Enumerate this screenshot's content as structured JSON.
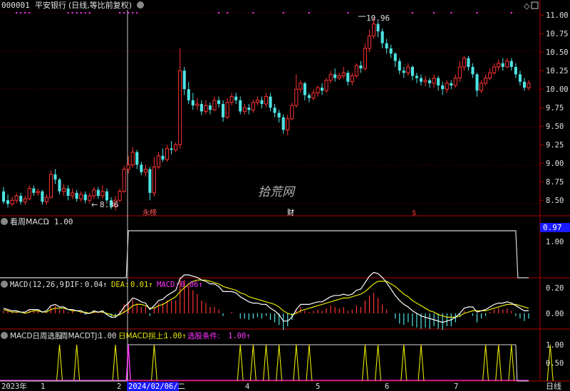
{
  "header": {
    "code": "000001",
    "name": "平安银行",
    "mode": "(日线,等比前复权)"
  },
  "watermark": "拾荒网",
  "colors": {
    "up": "#ff3333",
    "down": "#4fe3e3",
    "grid": "#7a0000",
    "axis_text": "#e0e0e0",
    "white": "#ffffff",
    "yellow": "#e6e600",
    "magenta": "#ff33ff",
    "blue_label": "#1a1aff"
  },
  "panels": {
    "price": {
      "high_label": "10.96",
      "low_label": "8.36",
      "y_ticks": [
        "11.00",
        "10.75",
        "10.50",
        "10.25",
        "10.00",
        "9.75",
        "9.50",
        "9.25",
        "9.00",
        "8.75",
        "8.50"
      ],
      "markers": [
        "永榜",
        "财",
        "$"
      ]
    },
    "weekly": {
      "title": "看周MACD",
      "value": "1.00",
      "current_label": "0.97",
      "tick": "1.00"
    },
    "macd": {
      "name": "MACD(12,26,9)",
      "dif_label": "DIF:",
      "dif": "0.04↑",
      "dea_label": "DEA:",
      "dea": "0.01↑",
      "macd_label": "MACD:",
      "macd": "0.06↑",
      "y_ticks": [
        "0.20",
        "0.00"
      ]
    },
    "signal": {
      "name": "MACD日周选股",
      "w_label": "周MACDTJ:",
      "w_value": "1.00",
      "d_label": "日MACD拐上:",
      "d_value": "1.00↑",
      "s_label": "选股条件:",
      "s_value": "1.00↑",
      "y_ticks": [
        "1.00",
        "0.50"
      ]
    }
  },
  "x_axis": {
    "labels": [
      "2023年",
      "1",
      "2",
      "2024/02/06/二",
      "4",
      "5",
      "6",
      "7"
    ],
    "period": "日线"
  },
  "chart_data": {
    "type": "candlestick",
    "y_range": [
      8.3,
      11.05
    ],
    "candles": [
      [
        8.62,
        8.48,
        8.68,
        8.45
      ],
      [
        8.5,
        8.45,
        8.58,
        8.4
      ],
      [
        8.45,
        8.5,
        8.55,
        8.42
      ],
      [
        8.5,
        8.56,
        8.6,
        8.46
      ],
      [
        8.56,
        8.48,
        8.6,
        8.44
      ],
      [
        8.48,
        8.52,
        8.56,
        8.44
      ],
      [
        8.52,
        8.66,
        8.7,
        8.5
      ],
      [
        8.66,
        8.6,
        8.7,
        8.56
      ],
      [
        8.6,
        8.62,
        8.66,
        8.56
      ],
      [
        8.62,
        8.48,
        8.64,
        8.44
      ],
      [
        8.48,
        8.54,
        8.58,
        8.44
      ],
      [
        8.54,
        8.85,
        8.9,
        8.52
      ],
      [
        8.85,
        8.78,
        8.92,
        8.72
      ],
      [
        8.78,
        8.62,
        8.8,
        8.58
      ],
      [
        8.62,
        8.66,
        8.72,
        8.56
      ],
      [
        8.66,
        8.56,
        8.7,
        8.5
      ],
      [
        8.56,
        8.6,
        8.66,
        8.52
      ],
      [
        8.6,
        8.52,
        8.64,
        8.48
      ],
      [
        8.52,
        8.58,
        8.62,
        8.48
      ],
      [
        8.58,
        8.5,
        8.62,
        8.46
      ],
      [
        8.5,
        8.56,
        8.6,
        8.46
      ],
      [
        8.56,
        8.64,
        8.68,
        8.52
      ],
      [
        8.64,
        8.56,
        8.68,
        8.52
      ],
      [
        8.56,
        8.62,
        8.7,
        8.52
      ],
      [
        8.62,
        8.5,
        8.66,
        8.46
      ],
      [
        8.5,
        8.42,
        8.54,
        8.38
      ],
      [
        8.42,
        8.5,
        8.56,
        8.36
      ],
      [
        8.5,
        8.62,
        8.66,
        8.48
      ],
      [
        8.62,
        8.92,
        8.96,
        8.6
      ],
      [
        8.92,
        8.98,
        9.1,
        8.86
      ],
      [
        8.98,
        9.15,
        9.22,
        8.94
      ],
      [
        9.15,
        8.98,
        9.18,
        8.92
      ],
      [
        8.98,
        8.88,
        9.02,
        8.84
      ],
      [
        8.88,
        8.92,
        8.98,
        8.82
      ],
      [
        8.92,
        8.6,
        8.95,
        8.5
      ],
      [
        8.6,
        8.95,
        9.08,
        8.55
      ],
      [
        8.95,
        9.1,
        9.15,
        8.92
      ],
      [
        9.1,
        9.05,
        9.2,
        9.02
      ],
      [
        9.05,
        9.2,
        9.25,
        9.02
      ],
      [
        9.2,
        9.18,
        9.3,
        9.12
      ],
      [
        9.18,
        9.25,
        9.28,
        9.15
      ],
      [
        9.25,
        10.25,
        10.55,
        9.2
      ],
      [
        10.25,
        10.0,
        10.3,
        9.92
      ],
      [
        10.0,
        9.85,
        10.1,
        9.8
      ],
      [
        9.85,
        9.78,
        9.95,
        9.72
      ],
      [
        9.78,
        9.8,
        9.88,
        9.72
      ],
      [
        9.8,
        9.7,
        9.85,
        9.65
      ],
      [
        9.7,
        9.78,
        9.85,
        9.66
      ],
      [
        9.78,
        9.72,
        9.82,
        9.66
      ],
      [
        9.72,
        9.85,
        9.9,
        9.7
      ],
      [
        9.85,
        9.8,
        9.9,
        9.75
      ],
      [
        9.8,
        9.62,
        9.85,
        9.56
      ],
      [
        9.62,
        9.82,
        9.88,
        9.6
      ],
      [
        9.82,
        9.9,
        9.95,
        9.78
      ],
      [
        9.9,
        9.85,
        9.95,
        9.8
      ],
      [
        9.85,
        9.7,
        9.9,
        9.66
      ],
      [
        9.7,
        9.75,
        9.8,
        9.66
      ],
      [
        9.75,
        9.72,
        9.8,
        9.66
      ],
      [
        9.72,
        9.82,
        9.86,
        9.68
      ],
      [
        9.82,
        9.85,
        9.9,
        9.78
      ],
      [
        9.85,
        9.8,
        9.9,
        9.74
      ],
      [
        9.8,
        9.9,
        9.95,
        9.76
      ],
      [
        9.9,
        9.75,
        9.95,
        9.7
      ],
      [
        9.75,
        9.68,
        9.8,
        9.62
      ],
      [
        9.68,
        9.62,
        9.72,
        9.55
      ],
      [
        9.62,
        9.45,
        9.66,
        9.4
      ],
      [
        9.45,
        9.6,
        9.65,
        9.38
      ],
      [
        9.6,
        9.78,
        9.82,
        9.58
      ],
      [
        9.78,
        10.0,
        10.2,
        9.75
      ],
      [
        10.0,
        10.08,
        10.12,
        9.95
      ],
      [
        10.08,
        9.92,
        10.1,
        9.85
      ],
      [
        9.92,
        9.88,
        9.95,
        9.82
      ],
      [
        9.88,
        9.95,
        10.0,
        9.85
      ],
      [
        9.95,
        10.02,
        10.05,
        9.9
      ],
      [
        10.02,
        9.98,
        10.08,
        9.92
      ],
      [
        9.98,
        10.12,
        10.15,
        9.95
      ],
      [
        10.12,
        10.2,
        10.25,
        10.08
      ],
      [
        10.2,
        10.15,
        10.28,
        10.1
      ],
      [
        10.15,
        10.18,
        10.22,
        10.12
      ],
      [
        10.18,
        10.22,
        10.3,
        10.14
      ],
      [
        10.22,
        10.1,
        10.25,
        10.05
      ],
      [
        10.1,
        10.18,
        10.22,
        10.05
      ],
      [
        10.18,
        10.32,
        10.35,
        10.15
      ],
      [
        10.32,
        10.28,
        10.38,
        10.22
      ],
      [
        10.28,
        10.55,
        10.62,
        10.25
      ],
      [
        10.55,
        10.72,
        10.8,
        10.5
      ],
      [
        10.72,
        10.88,
        10.96,
        10.68
      ],
      [
        10.88,
        10.78,
        10.92,
        10.7
      ],
      [
        10.78,
        10.62,
        10.82,
        10.55
      ],
      [
        10.62,
        10.55,
        10.68,
        10.48
      ],
      [
        10.55,
        10.48,
        10.6,
        10.42
      ],
      [
        10.48,
        10.38,
        10.5,
        10.3
      ],
      [
        10.38,
        10.25,
        10.42,
        10.2
      ],
      [
        10.25,
        10.22,
        10.3,
        10.15
      ],
      [
        10.22,
        10.3,
        10.35,
        10.18
      ],
      [
        10.3,
        10.18,
        10.32,
        10.12
      ],
      [
        10.18,
        10.15,
        10.22,
        10.08
      ],
      [
        10.15,
        10.1,
        10.2,
        10.05
      ],
      [
        10.1,
        10.12,
        10.18,
        10.04
      ],
      [
        10.12,
        10.08,
        10.15,
        10.02
      ],
      [
        10.08,
        10.15,
        10.2,
        10.02
      ],
      [
        10.15,
        10.05,
        10.18,
        9.98
      ],
      [
        10.05,
        10.0,
        10.1,
        9.92
      ],
      [
        10.0,
        10.08,
        10.12,
        9.95
      ],
      [
        10.08,
        10.05,
        10.12,
        10.0
      ],
      [
        10.05,
        10.15,
        10.2,
        10.02
      ],
      [
        10.15,
        10.3,
        10.38,
        10.1
      ],
      [
        10.3,
        10.42,
        10.45,
        10.25
      ],
      [
        10.42,
        10.3,
        10.45,
        10.25
      ],
      [
        10.3,
        10.2,
        10.35,
        10.15
      ],
      [
        10.2,
        9.98,
        10.22,
        9.9
      ],
      [
        9.98,
        10.08,
        10.12,
        9.95
      ],
      [
        10.08,
        10.15,
        10.2,
        10.05
      ],
      [
        10.15,
        10.22,
        10.28,
        10.12
      ],
      [
        10.22,
        10.3,
        10.35,
        10.2
      ],
      [
        10.3,
        10.35,
        10.4,
        10.25
      ],
      [
        10.35,
        10.3,
        10.42,
        10.25
      ],
      [
        10.3,
        10.38,
        10.42,
        10.28
      ],
      [
        10.38,
        10.3,
        10.42,
        10.25
      ],
      [
        10.3,
        10.2,
        10.35,
        10.15
      ],
      [
        10.2,
        10.1,
        10.25,
        10.05
      ],
      [
        10.1,
        10.02,
        10.15,
        9.98
      ],
      [
        10.02,
        10.08,
        10.12,
        9.98
      ]
    ],
    "macd_hist": [
      0.02,
      0.03,
      0.02,
      0.01,
      0.0,
      0.01,
      0.03,
      0.02,
      0.02,
      0.0,
      0.01,
      0.05,
      0.06,
      0.03,
      0.03,
      0.01,
      0.02,
      0.0,
      0.01,
      -0.01,
      0.0,
      0.02,
      0.01,
      0.02,
      -0.01,
      -0.03,
      -0.02,
      0.02,
      0.07,
      0.09,
      0.11,
      0.08,
      0.05,
      0.05,
      -0.02,
      0.05,
      0.08,
      0.08,
      0.1,
      0.1,
      0.1,
      0.28,
      0.26,
      0.22,
      0.18,
      0.15,
      0.1,
      0.08,
      0.05,
      0.05,
      0.03,
      -0.02,
      0.0,
      0.01,
      0.0,
      -0.04,
      -0.04,
      -0.05,
      -0.04,
      -0.03,
      -0.04,
      -0.02,
      -0.05,
      -0.07,
      -0.09,
      -0.13,
      -0.1,
      -0.05,
      0.03,
      0.05,
      0.02,
      0.01,
      0.02,
      0.03,
      0.02,
      0.04,
      0.06,
      0.05,
      0.04,
      0.05,
      0.02,
      0.03,
      0.06,
      0.05,
      0.1,
      0.14,
      0.16,
      0.12,
      0.07,
      0.03,
      0.0,
      -0.04,
      -0.08,
      -0.09,
      -0.07,
      -0.1,
      -0.11,
      -0.12,
      -0.11,
      -0.12,
      -0.1,
      -0.12,
      -0.13,
      -0.1,
      -0.1,
      -0.07,
      -0.03,
      0.02,
      0.0,
      -0.02,
      -0.07,
      -0.04,
      -0.02,
      0.01,
      0.03,
      0.04,
      0.03,
      0.04,
      0.02,
      -0.02,
      -0.04,
      -0.06,
      -0.04
    ],
    "dif": [
      0.04,
      0.03,
      0.02,
      0.02,
      0.01,
      0.01,
      0.03,
      0.03,
      0.03,
      0.01,
      0.02,
      0.06,
      0.07,
      0.05,
      0.05,
      0.03,
      0.03,
      0.02,
      0.02,
      0.0,
      0.0,
      0.02,
      0.01,
      0.02,
      -0.01,
      -0.03,
      -0.03,
      0.0,
      0.05,
      0.08,
      0.12,
      0.11,
      0.09,
      0.08,
      0.03,
      0.06,
      0.1,
      0.11,
      0.14,
      0.16,
      0.18,
      0.27,
      0.3,
      0.3,
      0.29,
      0.28,
      0.26,
      0.25,
      0.23,
      0.23,
      0.21,
      0.17,
      0.17,
      0.17,
      0.16,
      0.13,
      0.11,
      0.09,
      0.08,
      0.08,
      0.07,
      0.07,
      0.04,
      0.02,
      -0.01,
      -0.06,
      -0.06,
      -0.03,
      0.03,
      0.07,
      0.07,
      0.07,
      0.08,
      0.09,
      0.09,
      0.11,
      0.13,
      0.14,
      0.14,
      0.15,
      0.14,
      0.15,
      0.18,
      0.19,
      0.24,
      0.29,
      0.32,
      0.31,
      0.28,
      0.24,
      0.19,
      0.14,
      0.1,
      0.07,
      0.05,
      0.02,
      0.0,
      -0.02,
      -0.03,
      -0.04,
      -0.05,
      -0.06,
      -0.07,
      -0.06,
      -0.05,
      -0.03,
      0.0,
      0.04,
      0.05,
      0.05,
      0.01,
      0.02,
      0.03,
      0.05,
      0.07,
      0.08,
      0.08,
      0.09,
      0.08,
      0.06,
      0.04,
      0.02,
      0.02
    ],
    "dea": [
      0.03,
      0.02,
      0.01,
      0.01,
      0.01,
      0.0,
      0.01,
      0.02,
      0.02,
      0.01,
      0.01,
      0.03,
      0.04,
      0.04,
      0.04,
      0.03,
      0.02,
      0.02,
      0.01,
      0.01,
      0.0,
      0.01,
      0.01,
      0.01,
      0.0,
      -0.01,
      -0.02,
      -0.01,
      0.01,
      0.03,
      0.06,
      0.07,
      0.07,
      0.06,
      0.04,
      0.04,
      0.06,
      0.07,
      0.09,
      0.11,
      0.13,
      0.17,
      0.2,
      0.23,
      0.25,
      0.26,
      0.26,
      0.26,
      0.25,
      0.24,
      0.23,
      0.21,
      0.2,
      0.19,
      0.18,
      0.16,
      0.15,
      0.13,
      0.12,
      0.11,
      0.1,
      0.09,
      0.08,
      0.07,
      0.05,
      0.02,
      0.0,
      -0.01,
      0.0,
      0.02,
      0.03,
      0.04,
      0.05,
      0.06,
      0.07,
      0.08,
      0.09,
      0.1,
      0.11,
      0.12,
      0.12,
      0.13,
      0.14,
      0.15,
      0.17,
      0.2,
      0.23,
      0.25,
      0.25,
      0.25,
      0.23,
      0.21,
      0.18,
      0.15,
      0.13,
      0.1,
      0.08,
      0.06,
      0.04,
      0.02,
      0.01,
      -0.01,
      -0.02,
      -0.03,
      -0.03,
      -0.03,
      -0.02,
      0.0,
      0.01,
      0.02,
      0.02,
      0.02,
      0.02,
      0.03,
      0.04,
      0.05,
      0.06,
      0.07,
      0.07,
      0.07,
      0.06,
      0.05,
      0.04
    ],
    "weekly_macd": {
      "step_up_bar": 29,
      "step_down_bar": 119,
      "low": 0.0,
      "high": 1.0,
      "current": 0.97
    },
    "signal_spikes": [
      13,
      17,
      26,
      35,
      55,
      58,
      61,
      64,
      68,
      71,
      84,
      87,
      93,
      97,
      112,
      115,
      118,
      127,
      137,
      147
    ]
  }
}
